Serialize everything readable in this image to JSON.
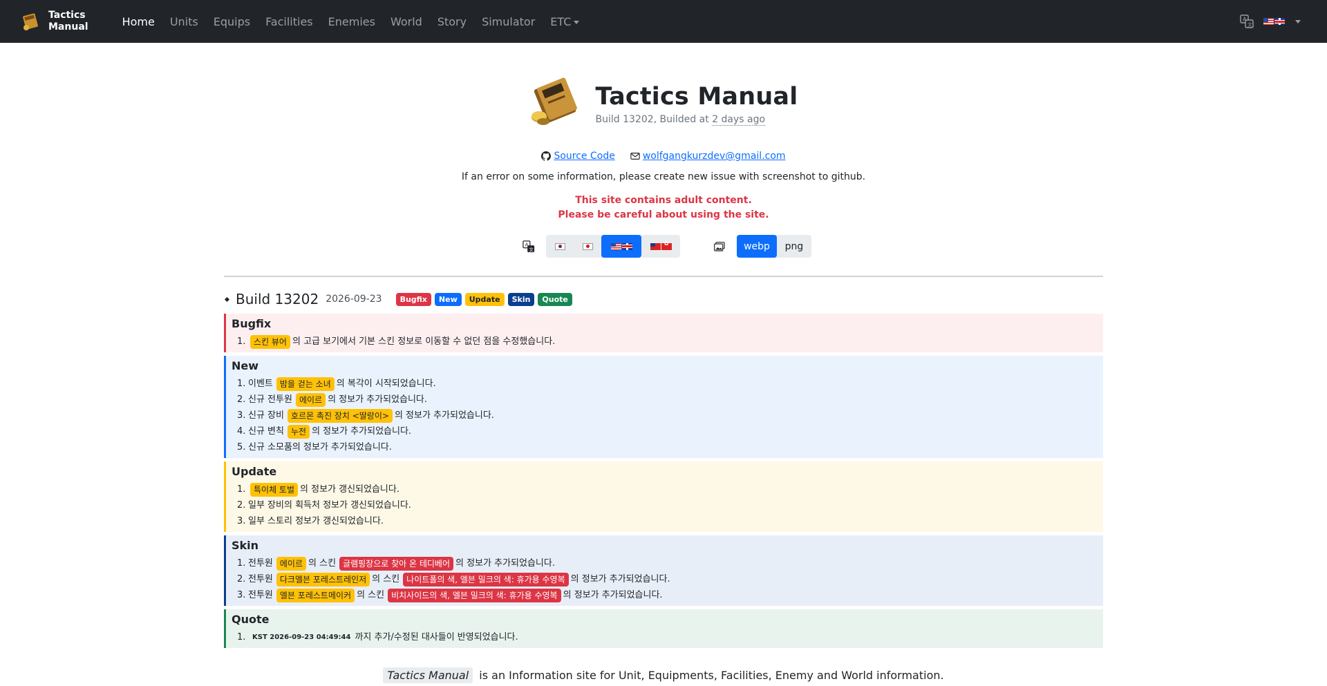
{
  "nav": {
    "brand_line1": "Tactics",
    "brand_line2": "Manual",
    "links": [
      "Home",
      "Units",
      "Equips",
      "Facilities",
      "Enemies",
      "World",
      "Story",
      "Simulator",
      "ETC"
    ]
  },
  "hero": {
    "title": "Tactics Manual",
    "build_prefix": "Build 13202, Builded at",
    "build_ago": "2 days ago",
    "source_label": "Source Code",
    "email": "wolfgangkurzdev@gmail.com",
    "note": "If an error on some information, please create new issue with screenshot to github.",
    "warn_line1": "This site contains adult content.",
    "warn_line2": "Please be careful about using the site."
  },
  "toolbar": {
    "format_webp": "webp",
    "format_png": "png"
  },
  "build": {
    "title": "Build 13202",
    "date": "2026-09-23",
    "badges": [
      "Bugfix",
      "New",
      "Update",
      "Skin",
      "Quote"
    ]
  },
  "sections": {
    "bugfix": {
      "title": "Bugfix",
      "items": [
        {
          "n": "1.",
          "chip1": "스킨 뷰어",
          "text": "의 고급 보기에서 기본 스킨 정보로 이동할 수 없던 점을 수정했습니다."
        }
      ]
    },
    "new": {
      "title": "New",
      "items": [
        {
          "n": "1.",
          "pre": "이벤트",
          "chip1": "밤을 걷는 소녀",
          "text": "의 복각이 시작되었습니다."
        },
        {
          "n": "2.",
          "pre": "신규 전투원",
          "chip1": "에이르",
          "text": "의 정보가 추가되었습니다."
        },
        {
          "n": "3.",
          "pre": "신규 장비",
          "chip1": "호르몬 촉진 장치 <딸랑이>",
          "text": "의 정보가 추가되었습니다."
        },
        {
          "n": "4.",
          "pre": "신규 변칙",
          "chip1": "누전",
          "text": "의 정보가 추가되었습니다."
        },
        {
          "n": "5.",
          "pre": "신규 소모품의 정보가 추가되었습니다."
        }
      ]
    },
    "update": {
      "title": "Update",
      "items": [
        {
          "n": "1.",
          "chip1": "특이체 토벌",
          "text": "의 정보가 갱신되었습니다."
        },
        {
          "n": "2.",
          "pre": "일부 장비의 획득처 정보가 갱신되었습니다."
        },
        {
          "n": "3.",
          "pre": "일부 스토리 정보가 갱신되었습니다."
        }
      ]
    },
    "skin": {
      "title": "Skin",
      "items": [
        {
          "n": "1.",
          "pre": "전투원",
          "chip1": "에이르",
          "mid": "의 스킨",
          "chip2": "글램핑장으로 찾아 온 테디베어",
          "text": "의 정보가 추가되었습니다."
        },
        {
          "n": "2.",
          "pre": "전투원",
          "chip1": "다크엘븐 포레스트레인저",
          "mid": "의 스킨",
          "chip2": "나이트폴의 색, 엘븐 밀크의 색: 휴가용 수영복",
          "text": "의 정보가 추가되었습니다."
        },
        {
          "n": "3.",
          "pre": "전투원",
          "chip1": "엘븐 포레스트메이커",
          "mid": "의 스킨",
          "chip2": "비치사이드의 색, 엘븐 밀크의 색: 휴가용 수영복",
          "text": "의 정보가 추가되었습니다."
        }
      ]
    },
    "quote": {
      "title": "Quote",
      "items": [
        {
          "n": "1.",
          "kst": "KST 2026-09-23 04:49:44",
          "text": "까지 추가/수정된 대사들이 반영되었습니다."
        }
      ]
    }
  },
  "footer": {
    "name": "Tactics Manual",
    "text": "is an Information site for Unit, Equipments, Facilities, Enemy and World information."
  },
  "colors": {
    "navbar": "#212529",
    "primary": "#0d6efd",
    "danger": "#dc3545",
    "warning": "#ffc107",
    "navy": "#0a3e8f",
    "success": "#198754"
  }
}
